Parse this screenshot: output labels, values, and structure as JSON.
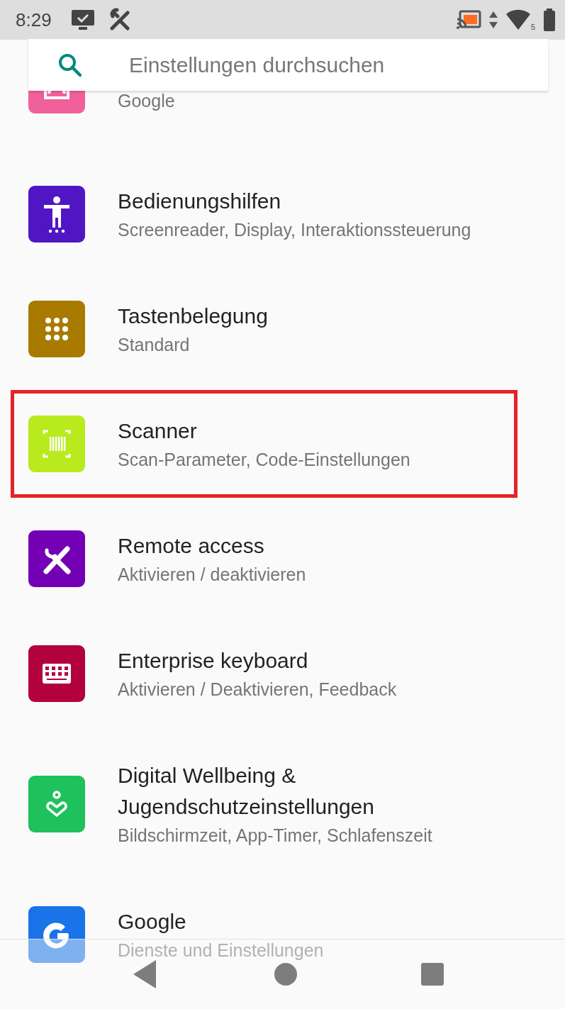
{
  "status_bar": {
    "time": "8:29",
    "wifi_label": "5"
  },
  "search": {
    "placeholder": "Einstellungen durchsuchen"
  },
  "items": [
    {
      "kind": "account",
      "color": "#f0609a",
      "subtitle": "Google",
      "highlighted": false
    },
    {
      "kind": "accessibility",
      "color": "#5116c4",
      "title": "Bedienungshilfen",
      "subtitle": "Screenreader, Display, Interaktionssteuerung",
      "highlighted": false
    },
    {
      "kind": "keypad",
      "color": "#a87b00",
      "title": "Tastenbelegung",
      "subtitle": "Standard",
      "highlighted": false
    },
    {
      "kind": "scanner",
      "color": "#b8ea1e",
      "title": "Scanner",
      "subtitle": "Scan-Parameter, Code-Einstellungen",
      "highlighted": true
    },
    {
      "kind": "tools",
      "color": "#7300b5",
      "title": "Remote access",
      "subtitle": "Aktivieren / deaktivieren",
      "highlighted": false
    },
    {
      "kind": "keyboard",
      "color": "#b3003f",
      "title": "Enterprise keyboard",
      "subtitle": "Aktivieren / Deaktivieren, Feedback",
      "highlighted": false
    },
    {
      "kind": "wellbeing",
      "color": "#1fc15c",
      "title": "Digital Wellbeing & Jugendschutzeinstellungen",
      "subtitle": "Bildschirmzeit, App-Timer, Schlafenszeit",
      "highlighted": false
    },
    {
      "kind": "google",
      "color": "#1a73e8",
      "title": "Google",
      "subtitle": "Dienste und Einstellungen",
      "highlighted": false
    }
  ]
}
